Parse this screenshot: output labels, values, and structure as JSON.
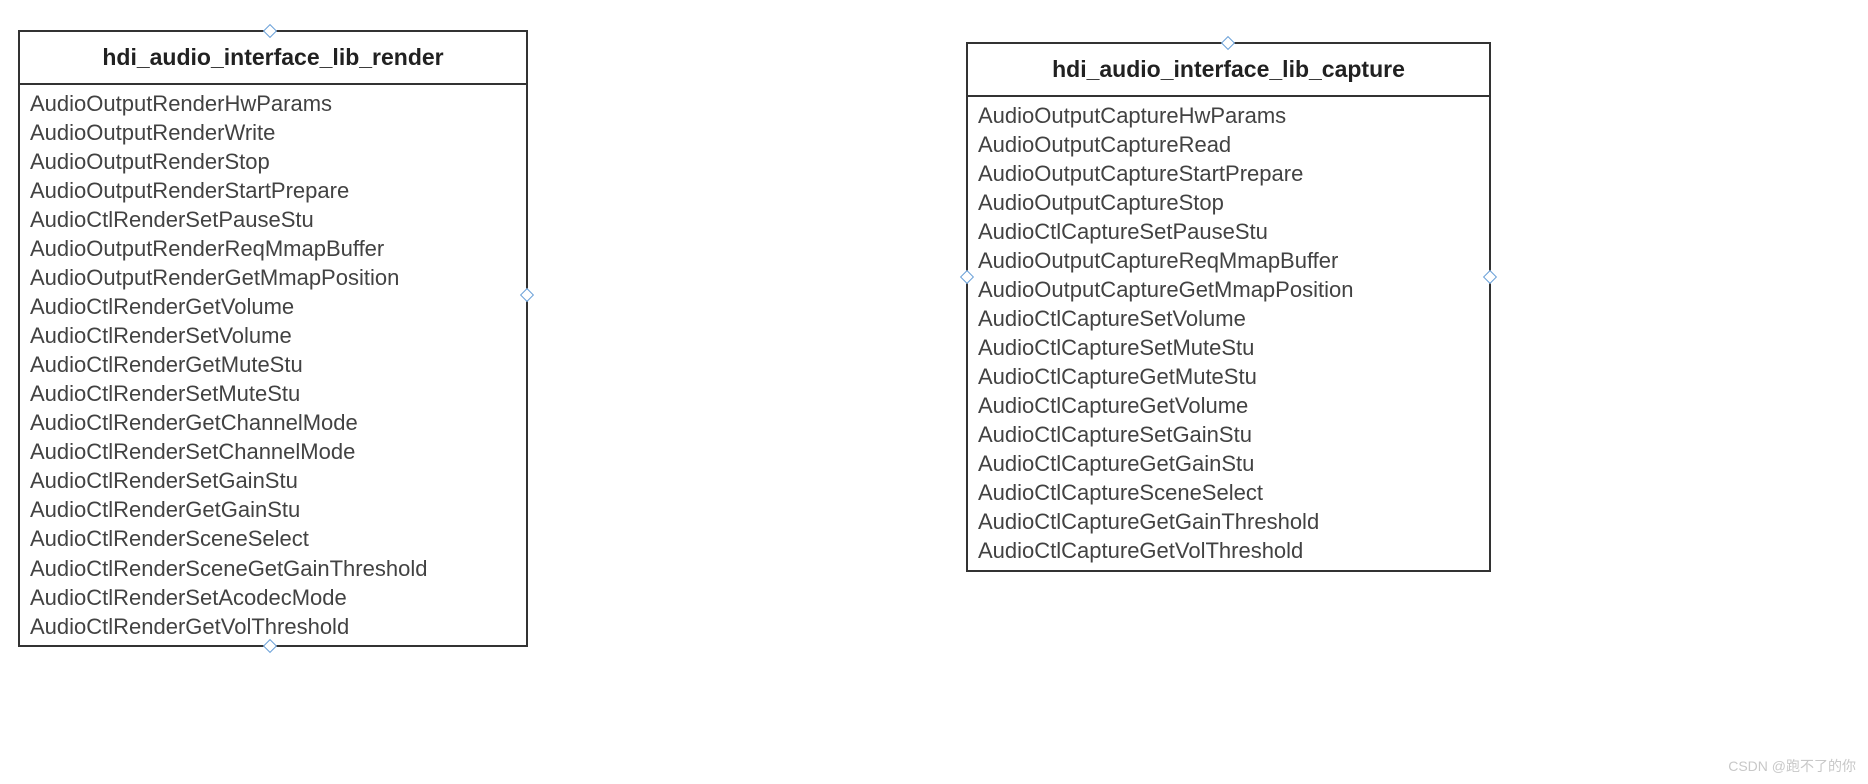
{
  "watermark": "CSDN @跑不了的你",
  "classes": {
    "render": {
      "title": "hdi_audio_interface_lib_render",
      "items": [
        "AudioOutputRenderHwParams",
        "AudioOutputRenderWrite",
        "AudioOutputRenderStop",
        "AudioOutputRenderStartPrepare",
        "AudioCtlRenderSetPauseStu",
        "AudioOutputRenderReqMmapBuffer",
        "AudioOutputRenderGetMmapPosition",
        "AudioCtlRenderGetVolume",
        "AudioCtlRenderSetVolume",
        "AudioCtlRenderGetMuteStu",
        "AudioCtlRenderSetMuteStu",
        "AudioCtlRenderGetChannelMode",
        "AudioCtlRenderSetChannelMode",
        "AudioCtlRenderSetGainStu",
        "AudioCtlRenderGetGainStu",
        "AudioCtlRenderSceneSelect",
        "AudioCtlRenderSceneGetGainThreshold",
        "AudioCtlRenderSetAcodecMode",
        "AudioCtlRenderGetVolThreshold"
      ]
    },
    "capture": {
      "title": "hdi_audio_interface_lib_capture",
      "items": [
        "AudioOutputCaptureHwParams",
        "AudioOutputCaptureRead",
        "AudioOutputCaptureStartPrepare",
        "AudioOutputCaptureStop",
        "AudioCtlCaptureSetPauseStu",
        "AudioOutputCaptureReqMmapBuffer",
        "AudioOutputCaptureGetMmapPosition",
        "AudioCtlCaptureSetVolume",
        "AudioCtlCaptureSetMuteStu",
        "AudioCtlCaptureGetMuteStu",
        "AudioCtlCaptureGetVolume",
        "AudioCtlCaptureSetGainStu",
        "AudioCtlCaptureGetGainStu",
        "AudioCtlCaptureSceneSelect",
        "AudioCtlCaptureGetGainThreshold",
        "AudioCtlCaptureGetVolThreshold"
      ]
    }
  }
}
